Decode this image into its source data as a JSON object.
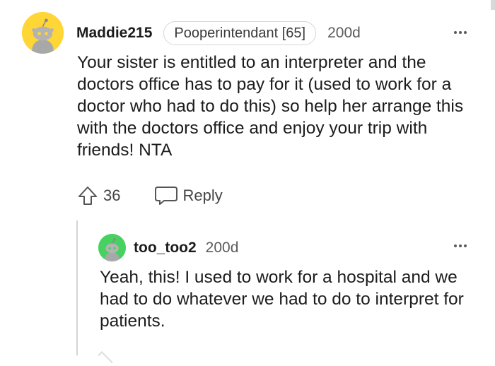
{
  "comment": {
    "username": "Maddie215",
    "flair": "Pooperintendant [65]",
    "age": "200d",
    "body": "Your sister is entitled to an interpreter and the doctors office has to pay for it (used to work for a doctor who had to do this) so help her arrange this with the doctors office and enjoy your trip with friends! NTA",
    "score": "36",
    "reply_label": "Reply",
    "avatar_color": "#ffd635"
  },
  "reply": {
    "username": "too_too2",
    "age": "200d",
    "body": "Yeah, this! I used to work for a hospital and we had to do whatever we had to do to interpret for patients.",
    "avatar_color": "#46d160"
  },
  "icons": {
    "more": "more-options-icon",
    "upvote": "upvote-arrow-icon",
    "reply": "speech-bubble-icon"
  }
}
